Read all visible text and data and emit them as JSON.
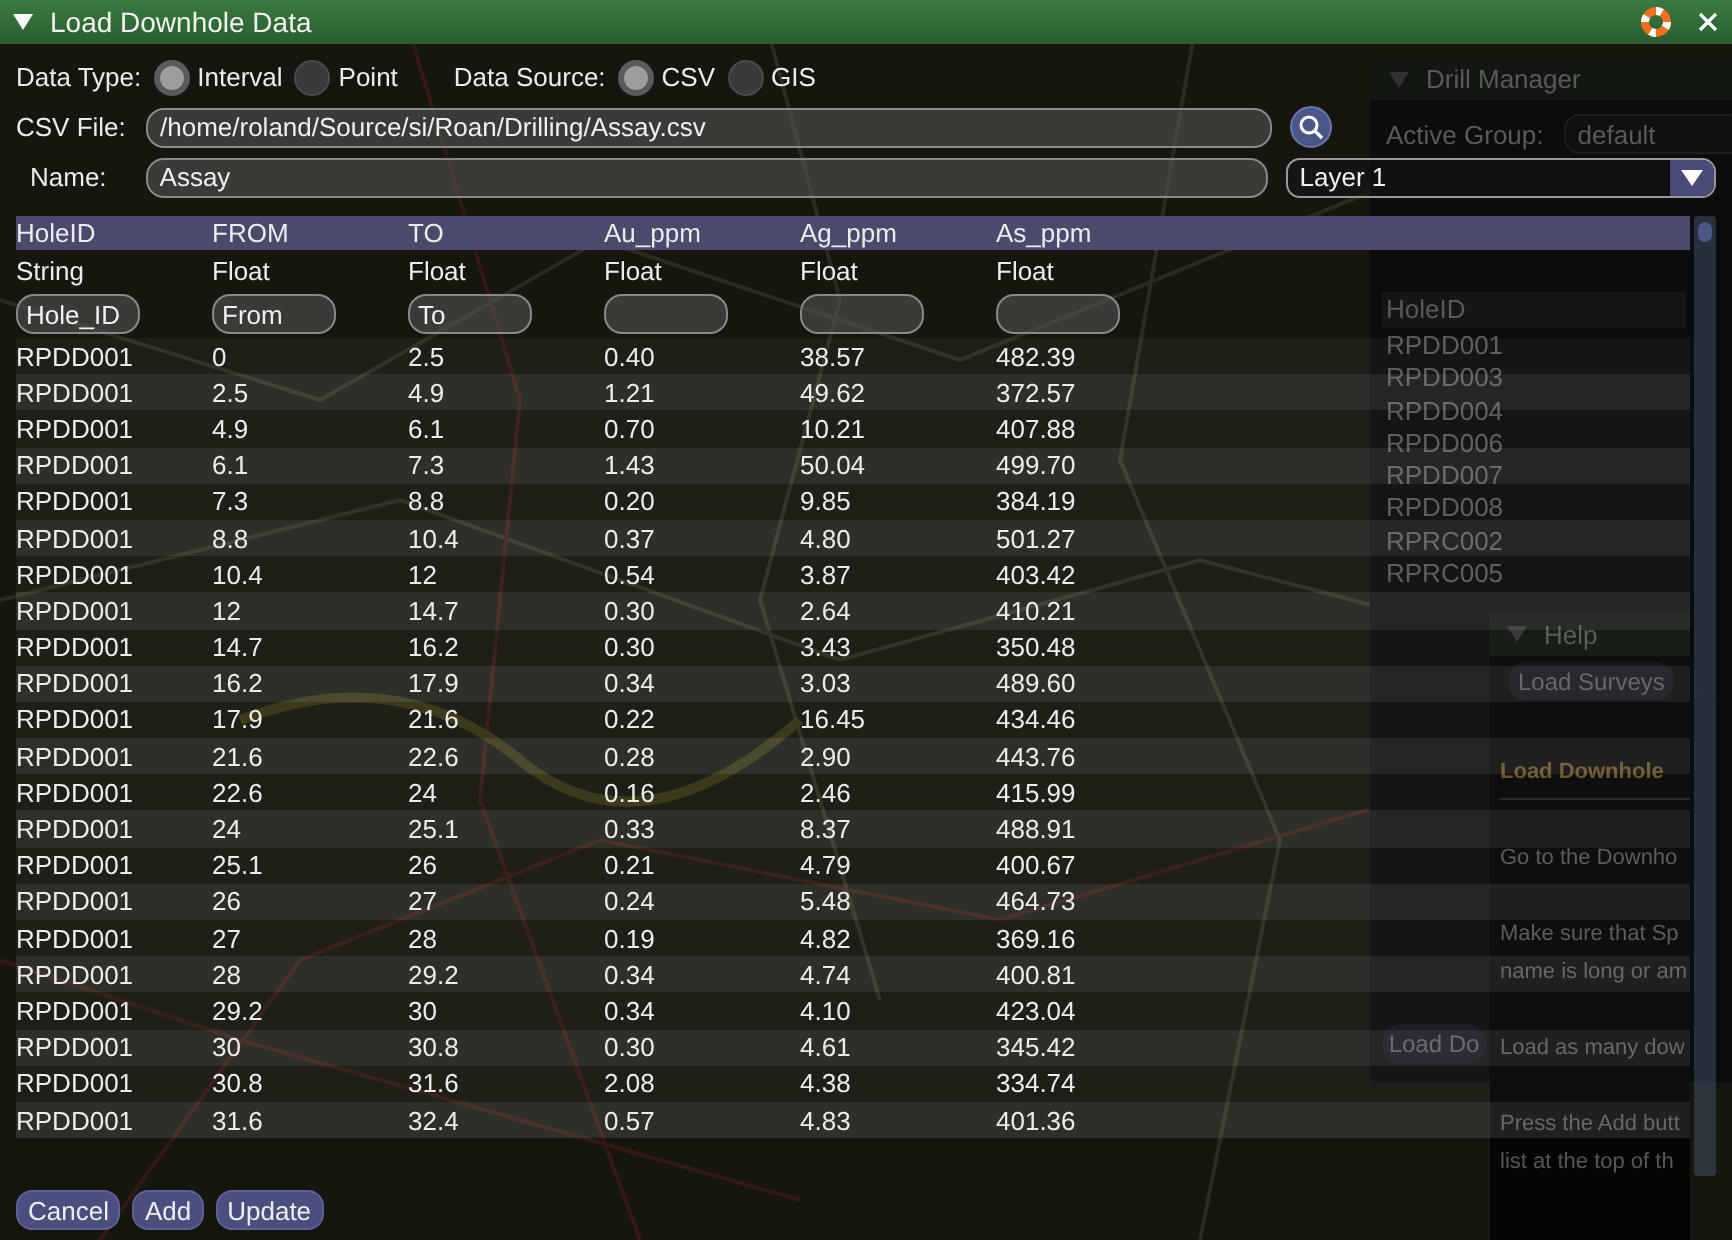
{
  "dialog": {
    "title": "Load Downhole Data",
    "data_type": {
      "label": "Data Type:",
      "options": [
        {
          "label": "Interval",
          "selected": true
        },
        {
          "label": "Point",
          "selected": false
        }
      ]
    },
    "data_source": {
      "label": "Data Source:",
      "options": [
        {
          "label": "CSV",
          "selected": true
        },
        {
          "label": "GIS",
          "selected": false
        }
      ]
    },
    "csv_file": {
      "label": "CSV File:",
      "value": "/home/roland/Source/si/Roan/Drilling/Assay.csv"
    },
    "name": {
      "label": "Name:",
      "value": "Assay"
    },
    "layer": {
      "value": "Layer 1"
    },
    "table": {
      "columns": [
        {
          "name": "HoleID",
          "type": "String",
          "field": "Hole_ID"
        },
        {
          "name": "FROM",
          "type": "Float",
          "field": "From"
        },
        {
          "name": "TO",
          "type": "Float",
          "field": "To"
        },
        {
          "name": "Au_ppm",
          "type": "Float"
        },
        {
          "name": "Ag_ppm",
          "type": "Float"
        },
        {
          "name": "As_ppm",
          "type": "Float"
        }
      ],
      "rows": [
        [
          "RPDD001",
          "0",
          "2.5",
          "0.40",
          "38.57",
          "482.39"
        ],
        [
          "RPDD001",
          "2.5",
          "4.9",
          "1.21",
          "49.62",
          "372.57"
        ],
        [
          "RPDD001",
          "4.9",
          "6.1",
          "0.70",
          "10.21",
          "407.88"
        ],
        [
          "RPDD001",
          "6.1",
          "7.3",
          "1.43",
          "50.04",
          "499.70"
        ],
        [
          "RPDD001",
          "7.3",
          "8.8",
          "0.20",
          "9.85",
          "384.19"
        ],
        [
          "RPDD001",
          "8.8",
          "10.4",
          "0.37",
          "4.80",
          "501.27"
        ],
        [
          "RPDD001",
          "10.4",
          "12",
          "0.54",
          "3.87",
          "403.42"
        ],
        [
          "RPDD001",
          "12",
          "14.7",
          "0.30",
          "2.64",
          "410.21"
        ],
        [
          "RPDD001",
          "14.7",
          "16.2",
          "0.30",
          "3.43",
          "350.48"
        ],
        [
          "RPDD001",
          "16.2",
          "17.9",
          "0.34",
          "3.03",
          "489.60"
        ],
        [
          "RPDD001",
          "17.9",
          "21.6",
          "0.22",
          "16.45",
          "434.46"
        ],
        [
          "RPDD001",
          "21.6",
          "22.6",
          "0.28",
          "2.90",
          "443.76"
        ],
        [
          "RPDD001",
          "22.6",
          "24",
          "0.16",
          "2.46",
          "415.99"
        ],
        [
          "RPDD001",
          "24",
          "25.1",
          "0.33",
          "8.37",
          "488.91"
        ],
        [
          "RPDD001",
          "25.1",
          "26",
          "0.21",
          "4.79",
          "400.67"
        ],
        [
          "RPDD001",
          "26",
          "27",
          "0.24",
          "5.48",
          "464.73"
        ],
        [
          "RPDD001",
          "27",
          "28",
          "0.19",
          "4.82",
          "369.16"
        ],
        [
          "RPDD001",
          "28",
          "29.2",
          "0.34",
          "4.74",
          "400.81"
        ],
        [
          "RPDD001",
          "29.2",
          "30",
          "0.34",
          "4.10",
          "423.04"
        ],
        [
          "RPDD001",
          "30",
          "30.8",
          "0.30",
          "4.61",
          "345.42"
        ],
        [
          "RPDD001",
          "30.8",
          "31.6",
          "2.08",
          "4.38",
          "334.74"
        ],
        [
          "RPDD001",
          "31.6",
          "32.4",
          "0.57",
          "4.83",
          "401.36"
        ]
      ]
    },
    "buttons": [
      "Cancel",
      "Add",
      "Update"
    ]
  },
  "drill_manager": {
    "title": "Drill Manager",
    "active_group": {
      "label": "Active Group:",
      "value": "default"
    },
    "list": {
      "header": "HoleID",
      "items": [
        "RPDD001",
        "RPDD003",
        "RPDD004",
        "RPDD006",
        "RPDD007",
        "RPDD008",
        "RPRC002",
        "RPRC005"
      ]
    },
    "button": "Load Do"
  },
  "help": {
    "title": "Help",
    "button": "Load Surveys",
    "blocks": [
      {
        "kind": "heading",
        "lines": [
          "Load Downhole"
        ]
      },
      {
        "kind": "paragraph",
        "lines": [
          "Go to the Downho"
        ]
      },
      {
        "kind": "paragraph",
        "lines": [
          "Make sure that Sp",
          "name is long or am"
        ]
      },
      {
        "kind": "paragraph",
        "lines": [
          "Load as many dow"
        ]
      },
      {
        "kind": "paragraph",
        "lines": [
          "Press the Add butt",
          "list at the top of th"
        ]
      }
    ]
  }
}
